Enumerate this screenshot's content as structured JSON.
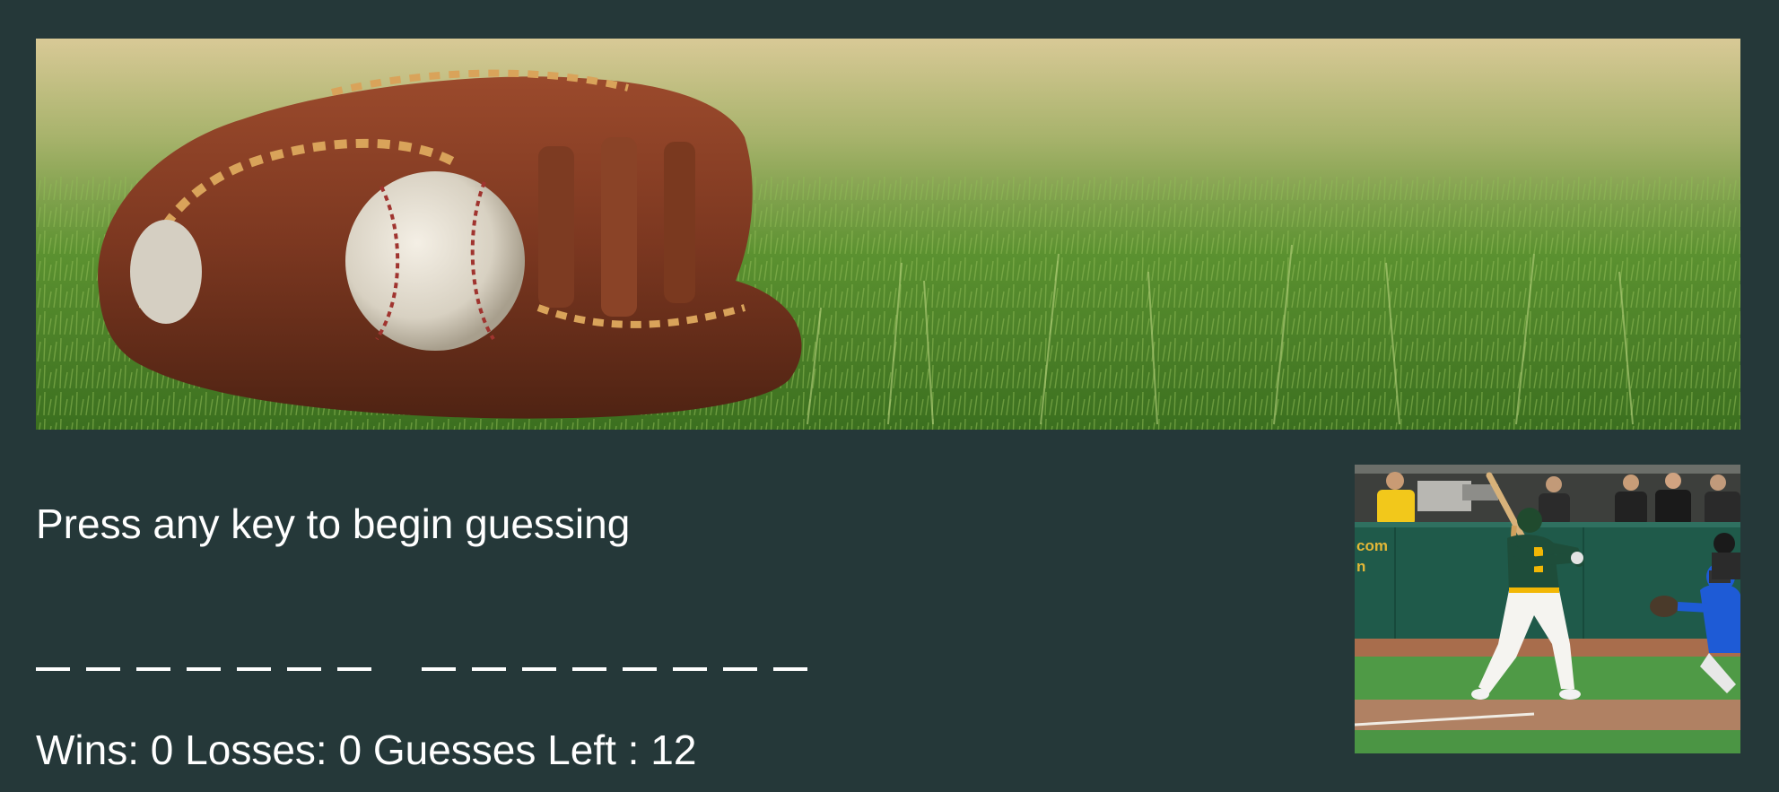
{
  "banner": {
    "alt": "Baseball in a leather glove resting on grass"
  },
  "game": {
    "prompt": "Press any key to begin guessing",
    "word_slots": {
      "first_word_length": 7,
      "second_word_length": 8,
      "revealed_letters": []
    },
    "stats": {
      "wins_label": "Wins: ",
      "wins": "0",
      "losses_label": " Losses: ",
      "losses": "0",
      "guesses_label": " Guesses Left : ",
      "guesses_left": "12"
    }
  },
  "player_photo": {
    "alt": "Batter in green and gold uniform at the plate with catcher",
    "wall_text": "com\nn"
  },
  "colors": {
    "background": "#253839",
    "text": "#ffffff",
    "wall": "#1f5a4a",
    "uniform_green": "#1e4d3a",
    "uniform_gold": "#f2b705",
    "catcher_blue": "#1e5bd6"
  }
}
